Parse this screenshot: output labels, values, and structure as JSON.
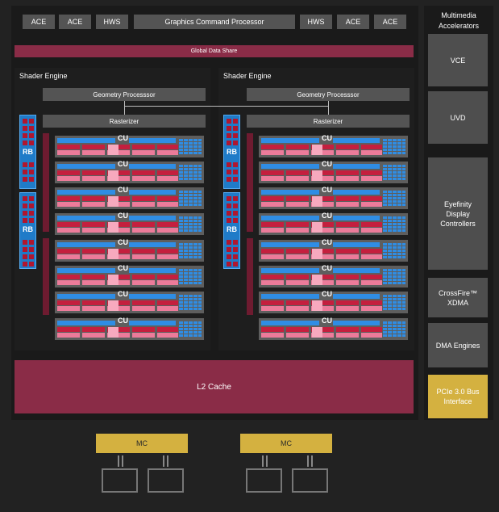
{
  "top_bar": {
    "left": [
      "ACE",
      "ACE",
      "HWS"
    ],
    "center": "Graphics Command Processor",
    "right": [
      "HWS",
      "ACE",
      "ACE"
    ]
  },
  "global_data_share": "Global Data Share",
  "shader_engines": [
    {
      "title": "Shader Engine",
      "geometry": "Geometry Processsor",
      "rasterizer": "Rasterizer",
      "rb_labels": [
        "RB",
        "RB"
      ],
      "cu_labels": [
        "CU",
        "CU",
        "CU",
        "CU",
        "CU",
        "CU",
        "CU",
        "CU"
      ]
    },
    {
      "title": "Shader Engine",
      "geometry": "Geometry Processsor",
      "rasterizer": "Rasterizer",
      "rb_labels": [
        "RB",
        "RB"
      ],
      "cu_labels": [
        "CU",
        "CU",
        "CU",
        "CU",
        "CU",
        "CU",
        "CU",
        "CU"
      ]
    }
  ],
  "l2_cache": "L2 Cache",
  "memory_controllers": [
    "MC",
    "MC"
  ],
  "sidebar": {
    "title": "Multimedia Accelerators",
    "vce": "VCE",
    "uvd": "UVD",
    "eyefinity": "Eyefinity Display Controllers",
    "crossfire": "CrossFire™ XDMA",
    "dma": "DMA Engines",
    "pcie": "PCIe 3.0 Bus Interface"
  },
  "colors": {
    "l2": "#8a2c47",
    "mc": "#d4b140",
    "rb": "#1f7bc8",
    "cu_red": "#c41f3e",
    "cu_pink": "#ec7b9a"
  }
}
